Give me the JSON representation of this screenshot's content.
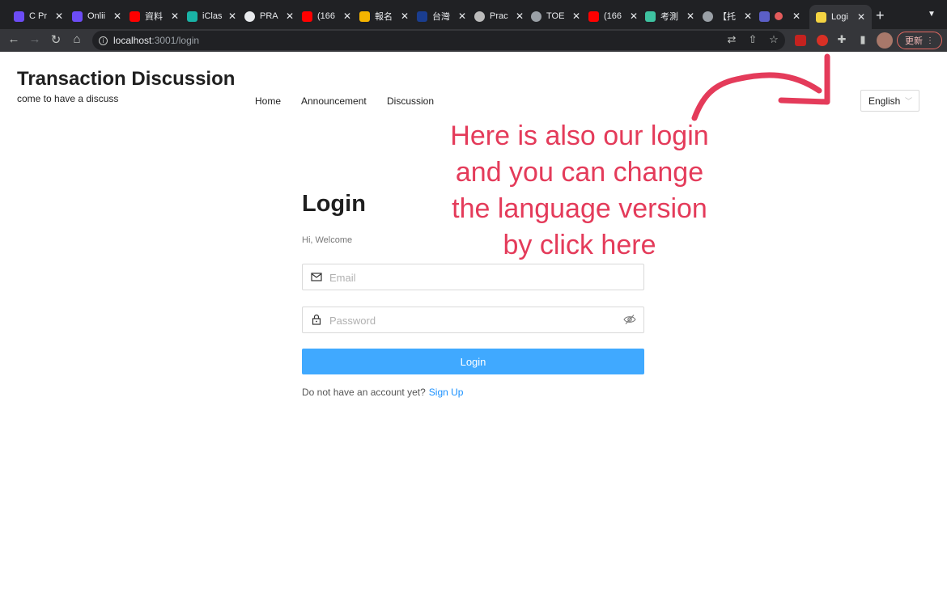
{
  "browser": {
    "tabs": [
      {
        "label": "C Pr",
        "color": "#6c4cf5"
      },
      {
        "label": "Onlii",
        "color": "#6c4cf5"
      },
      {
        "label": "資料",
        "color": "#ff0000"
      },
      {
        "label": "iClas",
        "color": "#19b3a6"
      },
      {
        "label": "PRA",
        "color": "#e8eaed"
      },
      {
        "label": "(166",
        "color": "#ff0000"
      },
      {
        "label": "報名",
        "color": "#f5b400"
      },
      {
        "label": "台灣",
        "color": "#1a3d8f"
      },
      {
        "label": "Prac",
        "color": "#bbbbbb"
      },
      {
        "label": "TOE",
        "color": "#9aa0a6"
      },
      {
        "label": "(166",
        "color": "#ff0000"
      },
      {
        "label": "考測",
        "color": "#3ec2a0"
      },
      {
        "label": "【托",
        "color": "#9aa0a6"
      },
      {
        "label": "",
        "color": "#5b5fc7"
      },
      {
        "label": "Logi",
        "color": "#f5d442"
      }
    ],
    "url_host": "localhost",
    "url_path": ":3001/login",
    "update_label": "更新"
  },
  "header": {
    "title": "Transaction Discussion",
    "subtitle": "come to have a discuss",
    "nav": [
      "Home",
      "Announcement",
      "Discussion"
    ],
    "language": "English"
  },
  "login": {
    "title": "Login",
    "welcome": "Hi, Welcome",
    "email_placeholder": "Email",
    "password_placeholder": "Password",
    "button": "Login",
    "no_account": "Do not have an account yet?",
    "signup": "Sign Up"
  },
  "annotation": {
    "lines": [
      "Here is also our login",
      "and you can change",
      "the language version",
      "by click here"
    ],
    "color": "#e43b5a"
  }
}
